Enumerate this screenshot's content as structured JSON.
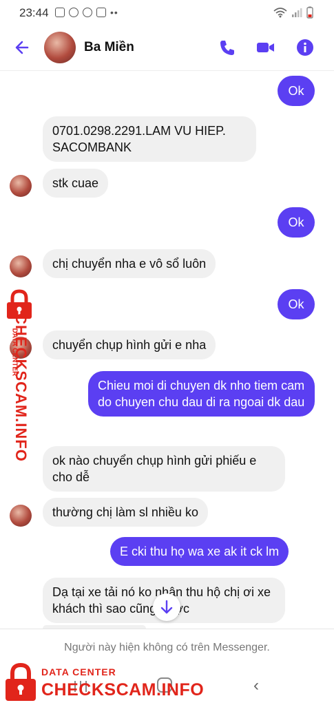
{
  "status_bar": {
    "time": "23:44"
  },
  "header": {
    "contact_name": "Ba Miền"
  },
  "messages": [
    {
      "from": "me",
      "text": "Ok"
    },
    {
      "from": "them",
      "text": "0701.0298.2291.LAM VU HIEP. SACOMBANK"
    },
    {
      "from": "them",
      "text": "stk cuae"
    },
    {
      "from": "me",
      "text": "Ok"
    },
    {
      "from": "them",
      "text": "chị chuyển nha e vô sổ luôn"
    },
    {
      "from": "me",
      "text": "Ok"
    },
    {
      "from": "them",
      "text": "chuyển chụp hình gửi e nha"
    },
    {
      "from": "me",
      "text": "Chieu moi di chuyen dk nho tiem cam do chuyen chu dau di ra ngoai dk dau"
    },
    {
      "from": "them",
      "text": "ok nào chuyển chụp hình gửi phiếu e cho dễ"
    },
    {
      "from": "them",
      "text": "thường chị làm sl nhiều ko"
    },
    {
      "from": "me",
      "text": "E cki thu họ wa xe ak it ck lm"
    },
    {
      "from": "them",
      "text": "Dạ tại xe tải nó ko nhận thu hộ chị ơi xe khách thì sao cũng được"
    }
  ],
  "notice": "Người này hiện không có trên Messenger.",
  "watermark": {
    "sub": "DATA CENTER",
    "main": "CHECKSCAM.INFO"
  },
  "colors": {
    "accent": "#5b3ff2",
    "incoming_bubble": "#f0f0f0",
    "watermark": "#e1251b"
  },
  "icons": [
    "back-arrow-icon",
    "phone-icon",
    "video-camera-icon",
    "info-icon",
    "scroll-down-icon",
    "lock-icon"
  ]
}
